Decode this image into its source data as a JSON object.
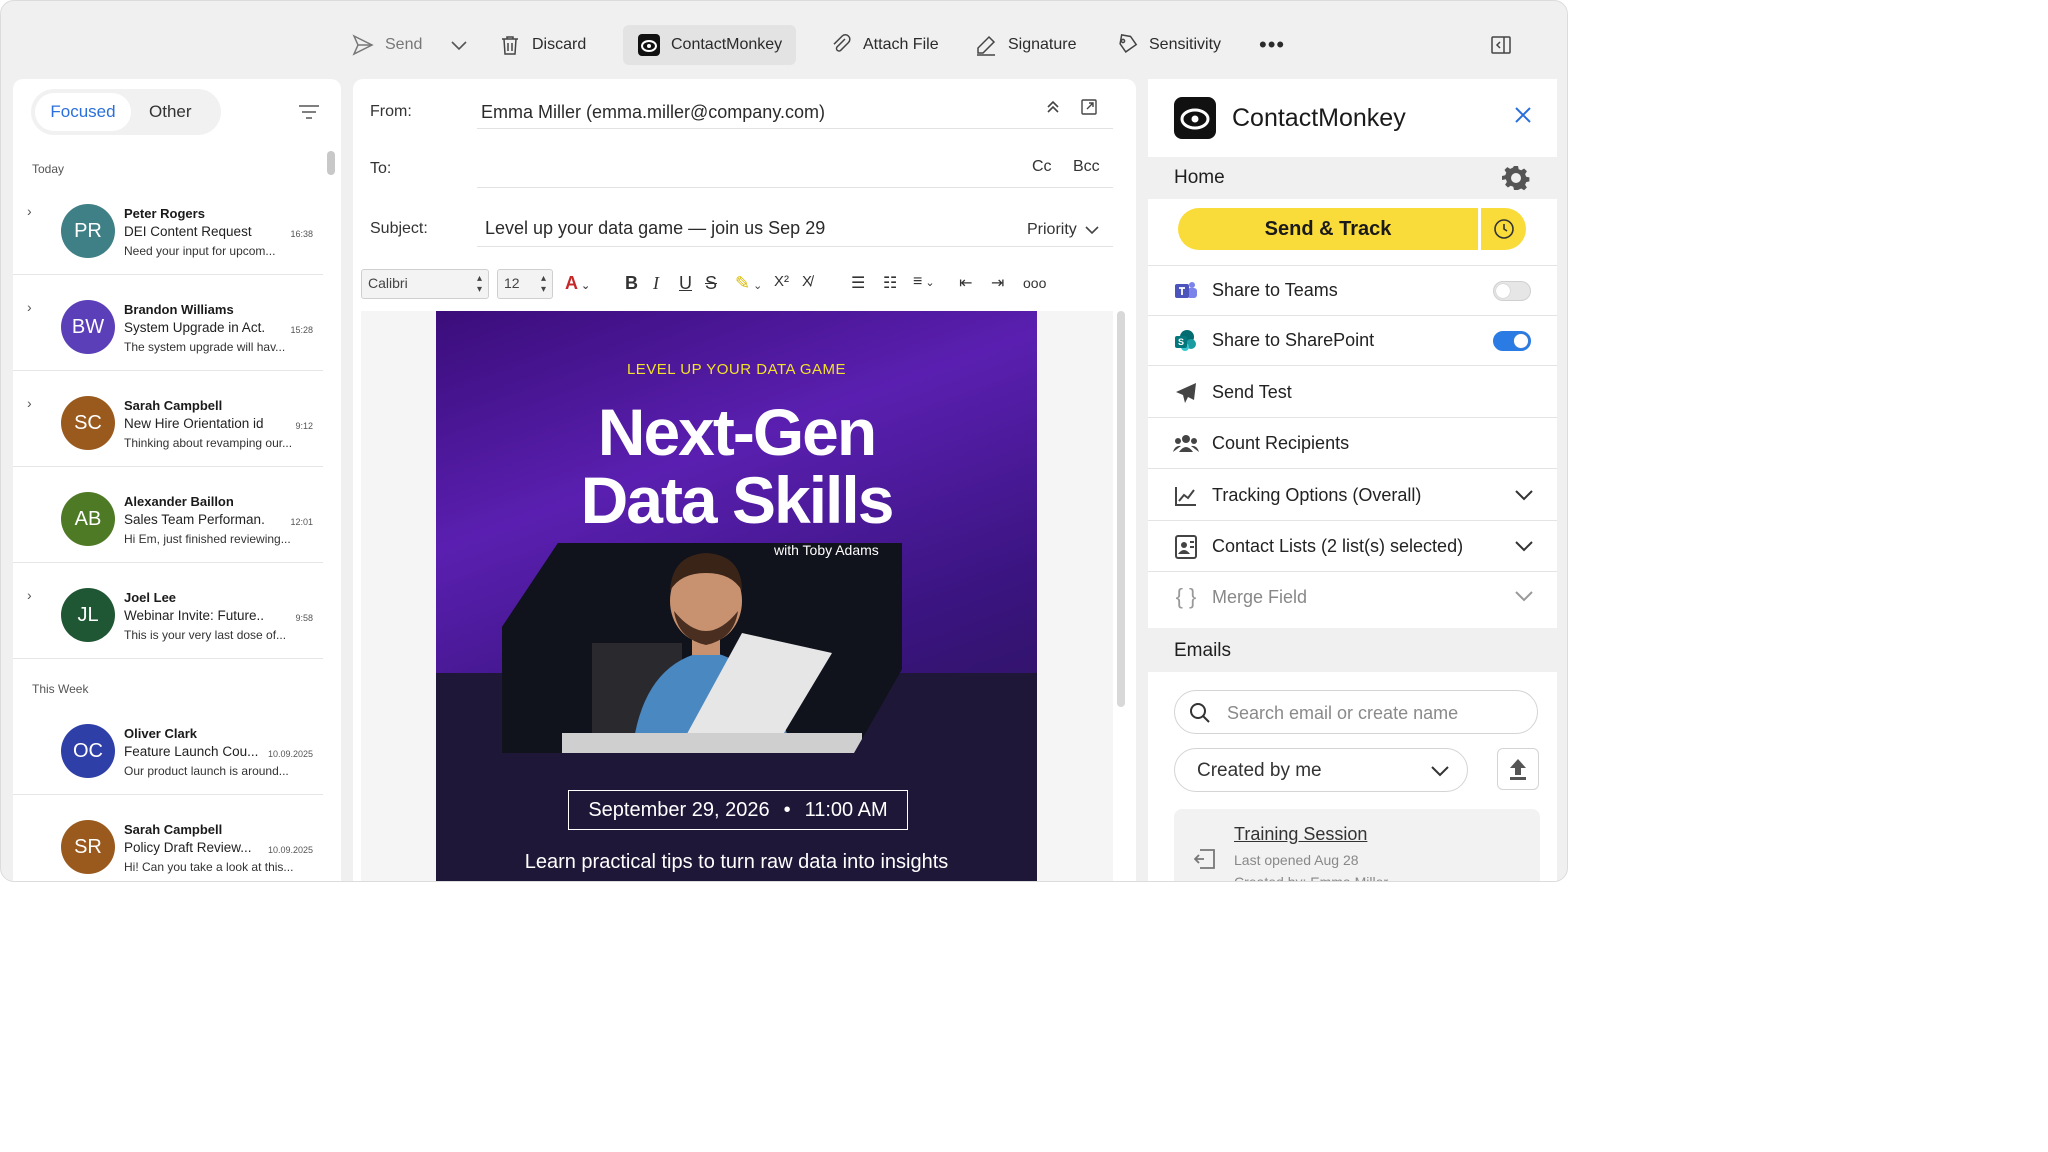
{
  "toolbar": {
    "send": "Send",
    "discard": "Discard",
    "contactmonkey": "ContactMonkey",
    "attach": "Attach File",
    "signature": "Signature",
    "sensitivity": "Sensitivity"
  },
  "inbox": {
    "tab_focused": "Focused",
    "tab_other": "Other",
    "group_today": "Today",
    "group_week": "This Week",
    "items": [
      {
        "initials": "PR",
        "color": "#3f7f86",
        "name": "Peter Rogers",
        "subject": "DEI Content Request",
        "time": "16:38",
        "preview": "Need your input for upcom..."
      },
      {
        "initials": "BW",
        "color": "#5b3fb8",
        "name": "Brandon Williams",
        "subject": "System Upgrade in Act...",
        "time": "15:28",
        "preview": "The system upgrade will hav..."
      },
      {
        "initials": "SC",
        "color": "#9a5a1e",
        "name": "Sarah Campbell",
        "subject": "New Hire Orientation ide...",
        "time": "9:12",
        "preview": "Thinking about revamping our..."
      },
      {
        "initials": "AB",
        "color": "#4f7a25",
        "name": "Alexander Baillon",
        "subject": "Sales Team Performan...",
        "time": "12:01",
        "preview": "Hi Em, just finished reviewing..."
      },
      {
        "initials": "JL",
        "color": "#1f5734",
        "name": "Joel Lee",
        "subject": "Webinar Invite: Future...",
        "time": "9:58",
        "preview": "This is your very last dose of..."
      },
      {
        "initials": "OC",
        "color": "#2f3fa8",
        "name": "Oliver Clark",
        "subject": "Feature Launch Cou...",
        "time": "10.09.2025",
        "preview": "Our product launch is around..."
      },
      {
        "initials": "SR",
        "color": "#9a5a1e",
        "name": "Sarah Campbell",
        "subject": "Policy Draft Review...",
        "time": "10.09.2025",
        "preview": "Hi! Can you take a look at this..."
      }
    ]
  },
  "compose": {
    "from_label": "From:",
    "from_value": "Emma Miller (emma.miller@company.com)",
    "to_label": "To:",
    "cc": "Cc",
    "bcc": "Bcc",
    "subject_label": "Subject:",
    "subject_value": "Level up your data game — join us Sep 29",
    "priority": "Priority",
    "font": "Calibri",
    "size": "12"
  },
  "flyer": {
    "kicker": "LEVEL UP YOUR DATA GAME",
    "headline_1": "Next-Gen",
    "headline_2": "Data Skills",
    "with": "with Toby Adams",
    "date": "September 29, 2026",
    "time": "11:00 AM",
    "tagline": "Learn practical tips to turn raw data into insights"
  },
  "sidebar": {
    "title": "ContactMonkey",
    "home": "Home",
    "send_track": "Send & Track",
    "share_teams": "Share to Teams",
    "share_sharepoint": "Share to SharePoint",
    "send_test": "Send Test",
    "count_recipients": "Count Recipients",
    "tracking": "Tracking Options (Overall)",
    "contact_lists": "Contact Lists (2 list(s) selected)",
    "merge_field": "Merge Field",
    "emails": "Emails",
    "search_placeholder": "Search email or create name",
    "created_by": "Created by me",
    "card_title": "Training Session",
    "card_sub": "Last opened Aug 28",
    "card_sub2": "Created by: Emma Miller"
  },
  "colors": {
    "accent": "#2a6fdb",
    "send_track": "#f9dc3a",
    "teams_toggle": "off",
    "sharepoint_toggle": "on"
  }
}
